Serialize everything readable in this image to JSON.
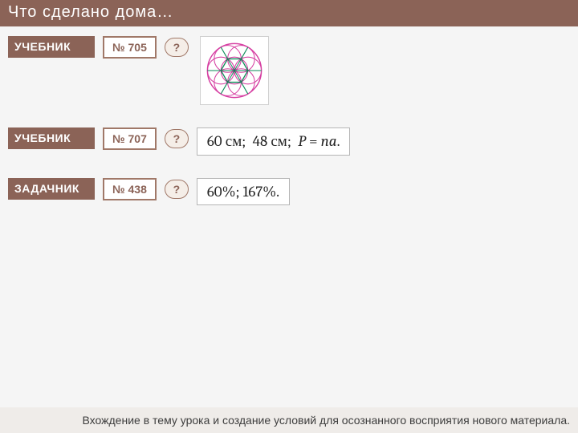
{
  "title": "Что  сделано  дома…",
  "rows": [
    {
      "source": "УЧЕБНИК",
      "number": "№ 705",
      "help": "?",
      "answer": null,
      "hasDiagram": true
    },
    {
      "source": "УЧЕБНИК",
      "number": "№ 707",
      "help": "?",
      "answer": "60 см;  48 см;  P = na.",
      "hasDiagram": false
    },
    {
      "source": "ЗАДАЧНИК",
      "number": "№ 438",
      "help": "?",
      "answer": "60%;  167%.",
      "hasDiagram": false
    }
  ],
  "footer": "Вхождение в тему урока и создание условий для осознанного восприятия нового материала.",
  "diagram": {
    "type": "flower-of-circles",
    "outerCircleColor": "#d63fa2",
    "petalCircleColor": "#d63fa2",
    "hexagonColor": "#0a8a57",
    "lineColor": "#0a8a57"
  }
}
